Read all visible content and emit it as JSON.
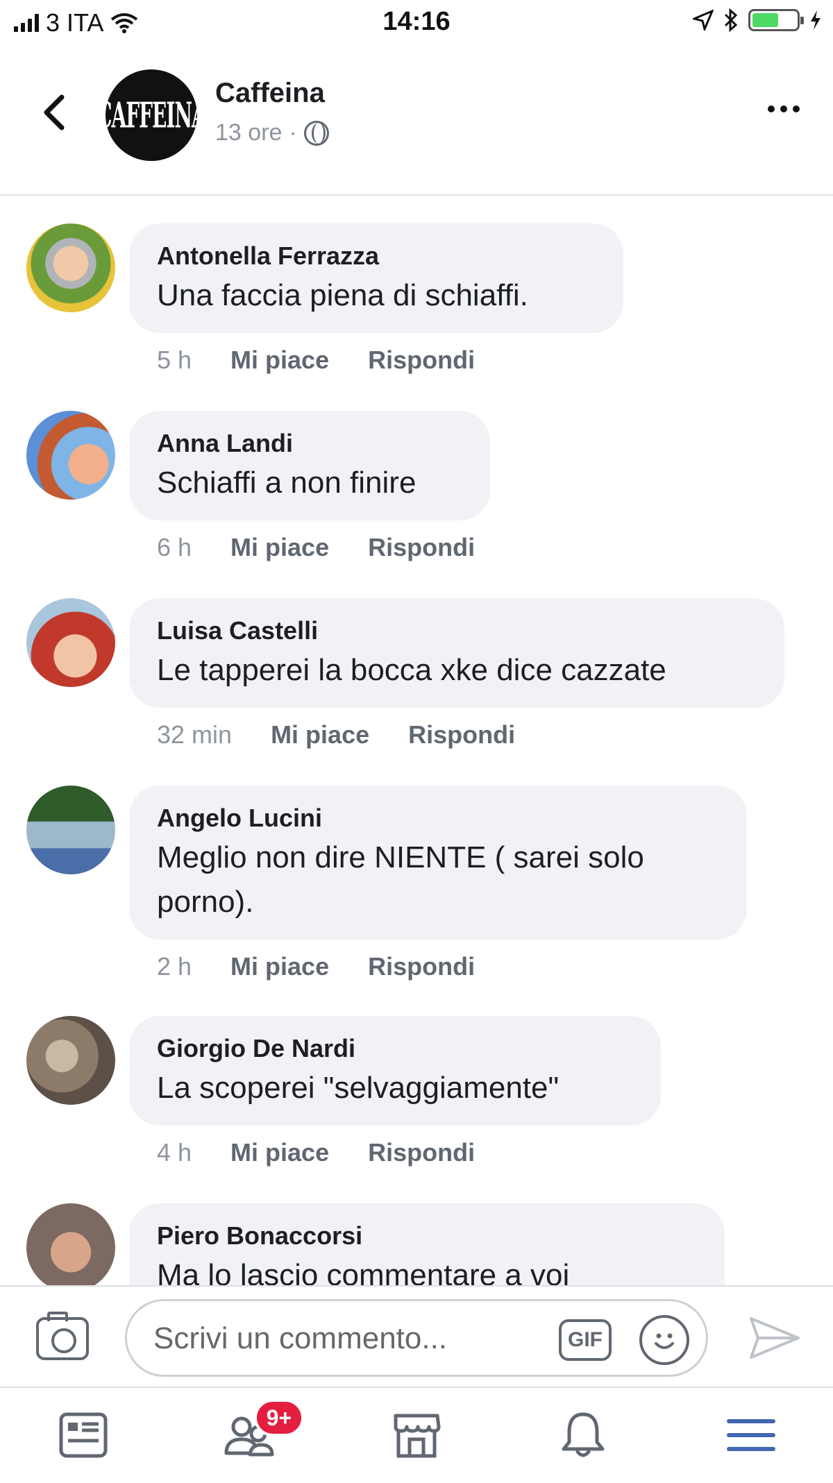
{
  "status_bar": {
    "carrier": "3 ITA",
    "time": "14:16"
  },
  "header": {
    "page_name": "Caffeina",
    "page_logo_text": "CAFFEINA",
    "time_ago": "13 ore",
    "separator": "·",
    "privacy_icon": "globe-icon"
  },
  "comments": [
    {
      "author": "Antonella Ferrazza",
      "text": "Una faccia piena di schiaffi.",
      "time": "5 h",
      "like": "Mi piace",
      "reply": "Rispondi"
    },
    {
      "author": "Anna Landi",
      "text": "Schiaffi a non finire",
      "time": "6 h",
      "like": "Mi piace",
      "reply": "Rispondi"
    },
    {
      "author": "Luisa Castelli",
      "text": "Le tapperei la bocca xke dice cazzate",
      "time": "32 min",
      "like": "Mi piace",
      "reply": "Rispondi"
    },
    {
      "author": "Angelo Lucini",
      "text": "Meglio non dire NIENTE ( sarei solo porno).",
      "time": "2 h",
      "like": "Mi piace",
      "reply": "Rispondi"
    },
    {
      "author": "Giorgio De Nardi",
      "text": "La scoperei \"selvaggiamente\"",
      "time": "4 h",
      "like": "Mi piace",
      "reply": "Rispondi"
    },
    {
      "author": "Piero Bonaccorsi",
      "text": "Ma lo lascio commentare a voi",
      "time": "",
      "like": "",
      "reply": ""
    }
  ],
  "composer": {
    "placeholder": "Scrivi un commento...",
    "gif_label": "GIF"
  },
  "tab_bar": {
    "friends_badge": "9+",
    "accent_color": "#4267b2"
  }
}
